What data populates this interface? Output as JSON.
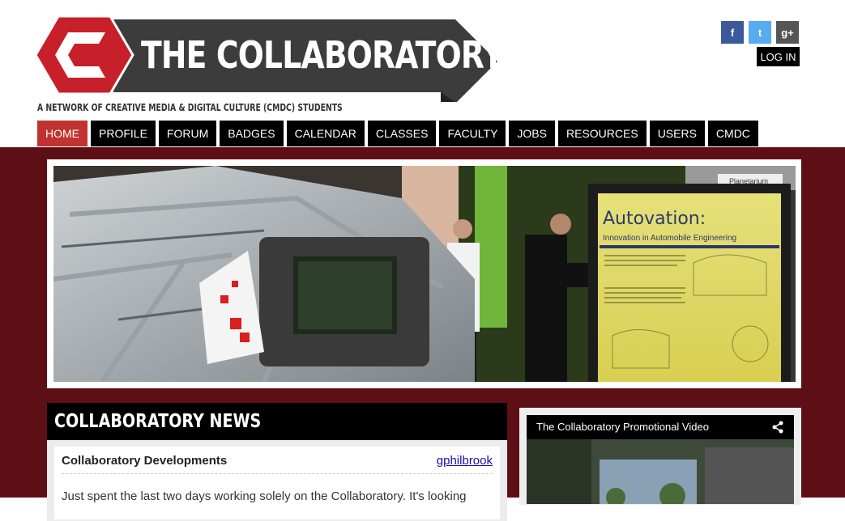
{
  "site": {
    "title": "THE COLLABORATORY",
    "tagline": "A NETWORK OF CREATIVE MEDIA & DIGITAL CULTURE (CMDC) STUDENTS",
    "brand_color": "#c8202a"
  },
  "social": {
    "facebook": "f",
    "twitter": "t",
    "googleplus": "g+"
  },
  "login_label": "LOG IN",
  "nav": [
    {
      "label": "HOME",
      "active": true
    },
    {
      "label": "PROFILE"
    },
    {
      "label": "FORUM"
    },
    {
      "label": "BADGES"
    },
    {
      "label": "CALENDAR"
    },
    {
      "label": "CLASSES"
    },
    {
      "label": "FACULTY"
    },
    {
      "label": "JOBS"
    },
    {
      "label": "RESOURCES"
    },
    {
      "label": "USERS"
    },
    {
      "label": "CMDC"
    }
  ],
  "banner": {
    "poster_title": "Autovation:",
    "poster_subtitle": "Innovation in Automobile Engineering",
    "sign_text": "Planetarium"
  },
  "news": {
    "heading": "COLLABORATORY NEWS",
    "post": {
      "title": "Collaboratory Developments",
      "author": "gphilbrook",
      "excerpt": "Just spent the last two days working solely on the Collaboratory. It's looking"
    }
  },
  "video": {
    "title": "The Collaboratory Promotional Video"
  }
}
